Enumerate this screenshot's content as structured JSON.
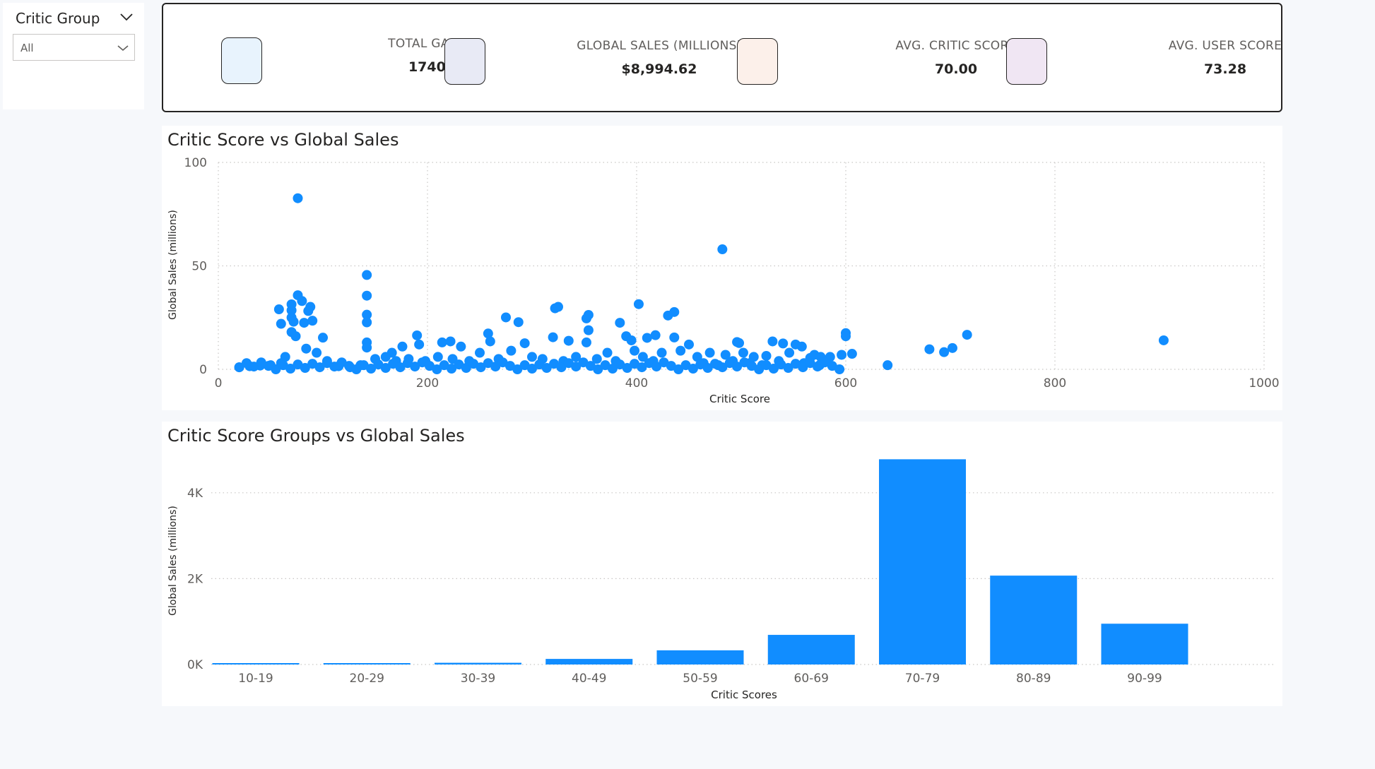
{
  "slicer": {
    "title": "Critic Group",
    "selected": "All"
  },
  "kpis": [
    {
      "label": "TOTAL GAMES",
      "value": "17408",
      "color": "#e8f3fd"
    },
    {
      "label": "GLOBAL SALES (MILLIONS)",
      "value": "$8,994.62",
      "color": "#e8eaf5"
    },
    {
      "label": "AVG. CRITIC SCORE",
      "value": "70.00",
      "color": "#fcf0ea"
    },
    {
      "label": "AVG. USER SCORE",
      "value": "73.28",
      "color": "#f0e6f3"
    }
  ],
  "colors": {
    "accent": "#118dff",
    "grid": "#c8c6c4",
    "axis_text": "#605e5c"
  },
  "chart_data": [
    {
      "type": "scatter",
      "title": "Critic Score vs Global Sales",
      "xlabel": "Critic Score",
      "ylabel": "Global Sales (millions)",
      "xlim": [
        0,
        1000
      ],
      "ylim": [
        0,
        100
      ],
      "xticks": [
        "0",
        "200",
        "400",
        "600",
        "800",
        "1000"
      ],
      "yticks": [
        "0",
        "50",
        "100"
      ],
      "grid": true,
      "points": [
        [
          76,
          82.7
        ],
        [
          76,
          35.8
        ],
        [
          80,
          33.0
        ],
        [
          70,
          31.4
        ],
        [
          88,
          30.2
        ],
        [
          58,
          29.0
        ],
        [
          70,
          28.5
        ],
        [
          86,
          28.2
        ],
        [
          70,
          25.0
        ],
        [
          72,
          23.0
        ],
        [
          82,
          22.5
        ],
        [
          60,
          22.0
        ],
        [
          90,
          23.5
        ],
        [
          100,
          15.3
        ],
        [
          70,
          18.0
        ],
        [
          74,
          16.0
        ],
        [
          142,
          45.6
        ],
        [
          142,
          35.6
        ],
        [
          142,
          26.4
        ],
        [
          142,
          22.7
        ],
        [
          142,
          13.0
        ],
        [
          142,
          10.5
        ],
        [
          166,
          8.0
        ],
        [
          176,
          11.0
        ],
        [
          190,
          16.4
        ],
        [
          192,
          12.0
        ],
        [
          214,
          13.0
        ],
        [
          222,
          13.5
        ],
        [
          232,
          11.0
        ],
        [
          258,
          17.3
        ],
        [
          260,
          13.5
        ],
        [
          275,
          25.1
        ],
        [
          287,
          22.8
        ],
        [
          293,
          12.6
        ],
        [
          320,
          15.5
        ],
        [
          322,
          29.5
        ],
        [
          325,
          30.2
        ],
        [
          335,
          13.8
        ],
        [
          352,
          24.6
        ],
        [
          354,
          26.3
        ],
        [
          354,
          18.9
        ],
        [
          352,
          13.0
        ],
        [
          384,
          22.5
        ],
        [
          390,
          16.0
        ],
        [
          395,
          14.0
        ],
        [
          402,
          31.5
        ],
        [
          410,
          15.2
        ],
        [
          418,
          16.5
        ],
        [
          430,
          26.0
        ],
        [
          436,
          27.7
        ],
        [
          436,
          15.4
        ],
        [
          450,
          12.0
        ],
        [
          470,
          8.0
        ],
        [
          482,
          58.0
        ],
        [
          485,
          7.0
        ],
        [
          496,
          13.2
        ],
        [
          498,
          12.7
        ],
        [
          502,
          8.0
        ],
        [
          512,
          6.0
        ],
        [
          524,
          6.5
        ],
        [
          530,
          13.5
        ],
        [
          540,
          12.5
        ],
        [
          546,
          8.0
        ],
        [
          552,
          12.0
        ],
        [
          558,
          11.0
        ],
        [
          566,
          5.5
        ],
        [
          570,
          7.0
        ],
        [
          576,
          6.0
        ],
        [
          585,
          6.0
        ],
        [
          596,
          7.0
        ],
        [
          600,
          17.5
        ],
        [
          600,
          16.0
        ],
        [
          606,
          7.5
        ],
        [
          640,
          2.0
        ],
        [
          680,
          9.7
        ],
        [
          694,
          8.3
        ],
        [
          702,
          10.3
        ],
        [
          716,
          16.7
        ],
        [
          904,
          14.0
        ],
        [
          20,
          1.0
        ],
        [
          30,
          1.5
        ],
        [
          40,
          1.8
        ],
        [
          50,
          2.0
        ],
        [
          60,
          3.0
        ],
        [
          64,
          6.0
        ],
        [
          84,
          10.0
        ],
        [
          94,
          8.0
        ],
        [
          104,
          4.0
        ],
        [
          115,
          1.5
        ],
        [
          126,
          1.0
        ],
        [
          136,
          2.0
        ],
        [
          150,
          5.0
        ],
        [
          160,
          6.0
        ],
        [
          170,
          4.0
        ],
        [
          182,
          5.0
        ],
        [
          198,
          4.0
        ],
        [
          210,
          6.0
        ],
        [
          224,
          5.0
        ],
        [
          240,
          4.0
        ],
        [
          250,
          8.0
        ],
        [
          268,
          5.0
        ],
        [
          280,
          9.0
        ],
        [
          300,
          6.0
        ],
        [
          310,
          5.0
        ],
        [
          330,
          4.0
        ],
        [
          342,
          6.0
        ],
        [
          362,
          5.0
        ],
        [
          372,
          8.0
        ],
        [
          380,
          4.0
        ],
        [
          398,
          9.0
        ],
        [
          406,
          6.0
        ],
        [
          416,
          4.0
        ],
        [
          424,
          8.0
        ],
        [
          442,
          9.0
        ],
        [
          458,
          6.0
        ],
        [
          464,
          3.0
        ],
        [
          478,
          2.0
        ],
        [
          492,
          4.0
        ],
        [
          508,
          3.0
        ],
        [
          520,
          2.0
        ],
        [
          536,
          4.0
        ],
        [
          560,
          3.0
        ],
        [
          575,
          2.0
        ]
      ]
    },
    {
      "type": "bar",
      "title": "Critic Score Groups vs Global Sales",
      "xlabel": "Critic Scores",
      "ylabel": "Global Sales (millions)",
      "categories": [
        "10-19",
        "20-29",
        "30-39",
        "40-49",
        "50-59",
        "60-69",
        "70-79",
        "80-89",
        "90-99"
      ],
      "values": [
        20,
        25,
        40,
        130,
        330,
        690,
        4780,
        2070,
        950
      ],
      "ylim": [
        0,
        5000
      ],
      "yticks": [
        "0K",
        "2K",
        "4K"
      ],
      "grid": true
    }
  ]
}
